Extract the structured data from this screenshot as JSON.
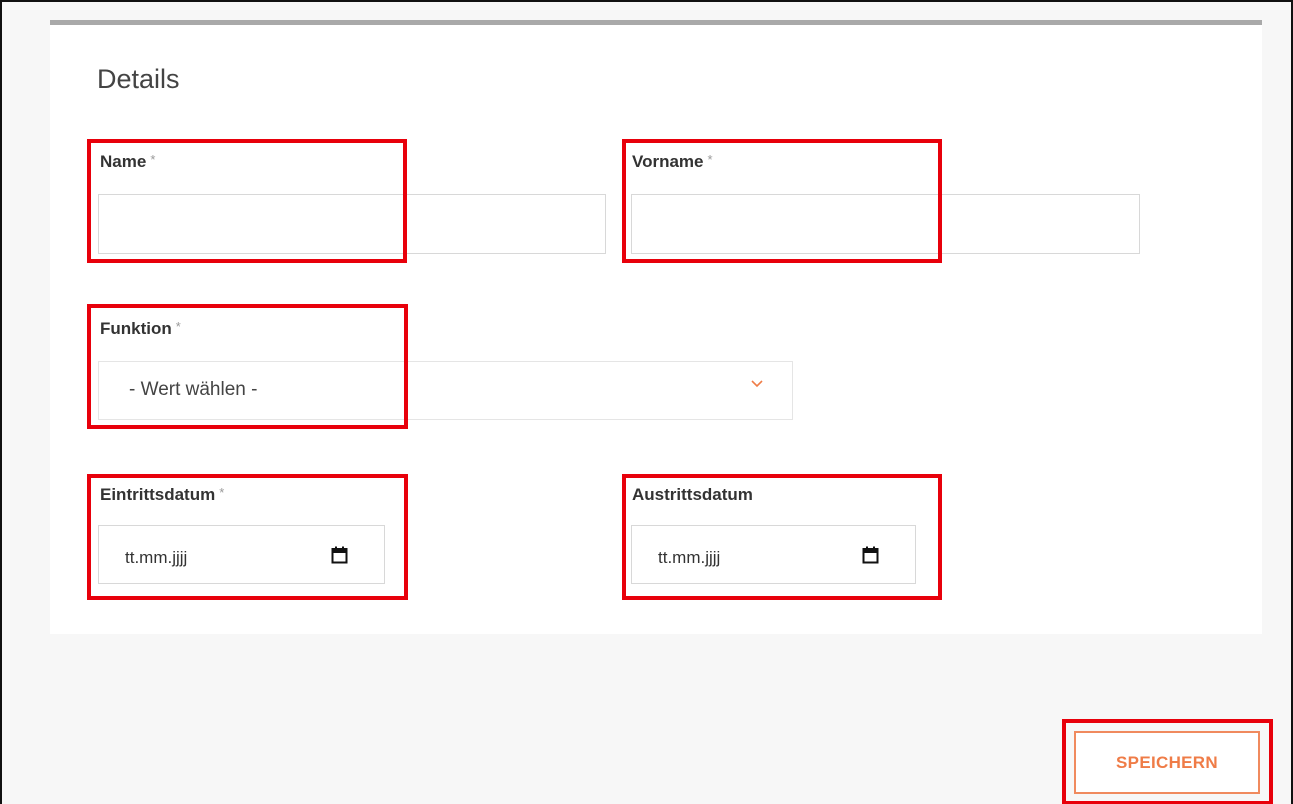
{
  "section": {
    "title": "Details"
  },
  "fields": {
    "name": {
      "label": "Name",
      "required_mark": "*",
      "value": ""
    },
    "vorname": {
      "label": "Vorname",
      "required_mark": "*",
      "value": ""
    },
    "funktion": {
      "label": "Funktion",
      "required_mark": "*",
      "selected": "- Wert wählen -"
    },
    "eintrittsdatum": {
      "label": "Eintrittsdatum",
      "required_mark": "*",
      "placeholder": "tt.mm.jjjj"
    },
    "austrittsdatum": {
      "label": "Austrittsdatum",
      "placeholder": "tt.mm.jjjj"
    }
  },
  "actions": {
    "save_label": "SPEICHERN"
  },
  "colors": {
    "accent": "#ef7c47",
    "highlight": "#e8000b",
    "card_border": "#a9a9a9"
  },
  "icons": {
    "dropdown": "chevron-down-icon",
    "date": "calendar-icon"
  }
}
